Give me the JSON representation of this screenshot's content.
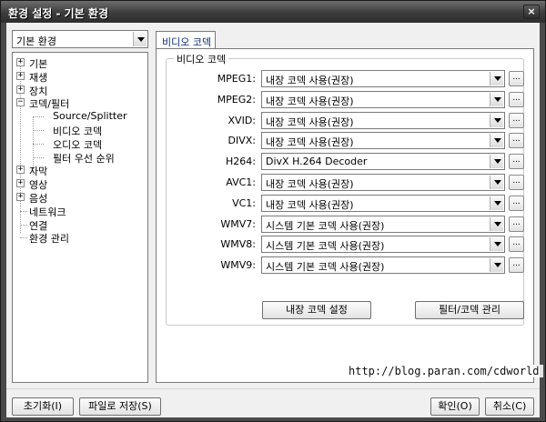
{
  "window": {
    "title": "환경 설정 - 기본 환경",
    "close_glyph": "×"
  },
  "left": {
    "combo_value": "기본 환경",
    "tree": [
      {
        "id": "basic",
        "label": "기본",
        "expander": "+"
      },
      {
        "id": "play",
        "label": "재생",
        "expander": "+"
      },
      {
        "id": "device",
        "label": "장치",
        "expander": "+"
      },
      {
        "id": "codec",
        "label": "코덱/필터",
        "expander": "−"
      },
      {
        "id": "splitter",
        "label": "Source/Splitter",
        "expander": ""
      },
      {
        "id": "video-codec",
        "label": "비디오 코덱",
        "expander": ""
      },
      {
        "id": "audio-codec",
        "label": "오디오 코덱",
        "expander": ""
      },
      {
        "id": "filter-priority",
        "label": "필터 우선 순위",
        "expander": ""
      },
      {
        "id": "subtitle",
        "label": "자막",
        "expander": "+"
      },
      {
        "id": "video",
        "label": "영상",
        "expander": "+"
      },
      {
        "id": "audio",
        "label": "음성",
        "expander": "+"
      },
      {
        "id": "network",
        "label": "네트워크",
        "expander": ""
      },
      {
        "id": "association",
        "label": "연결",
        "expander": ""
      },
      {
        "id": "env-manage",
        "label": "환경 관리",
        "expander": ""
      }
    ]
  },
  "right": {
    "tab_label": "비디오 코덱",
    "group_title": "비디오 코덱",
    "rows": [
      {
        "label": "MPEG1:",
        "value": "내장 코덱 사용(권장)"
      },
      {
        "label": "MPEG2:",
        "value": "내장 코덱 사용(권장)"
      },
      {
        "label": "XVID:",
        "value": "내장 코덱 사용(권장)"
      },
      {
        "label": "DIVX:",
        "value": "내장 코덱 사용(권장)"
      },
      {
        "label": "H264:",
        "value": "DivX H.264 Decoder"
      },
      {
        "label": "AVC1:",
        "value": "내장 코덱 사용(권장)"
      },
      {
        "label": "VC1:",
        "value": "내장 코덱 사용(권장)"
      },
      {
        "label": "WMV7:",
        "value": "시스템 기본 코덱 사용(권장)"
      },
      {
        "label": "WMV8:",
        "value": "시스템 기본 코덱 사용(권장)"
      },
      {
        "label": "WMV9:",
        "value": "시스템 기본 코덱 사용(권장)"
      }
    ],
    "dots_label": "...",
    "builtin_codec_settings": "내장 코덱 설정",
    "filter_codec_manage": "필터/코덱 관리",
    "watermark": "http://blog.paran.com/cdworld"
  },
  "footer": {
    "reset": "초기화(I)",
    "save_file": "파일로 저장(S)",
    "ok": "확인(O)",
    "cancel": "취소(C)"
  }
}
